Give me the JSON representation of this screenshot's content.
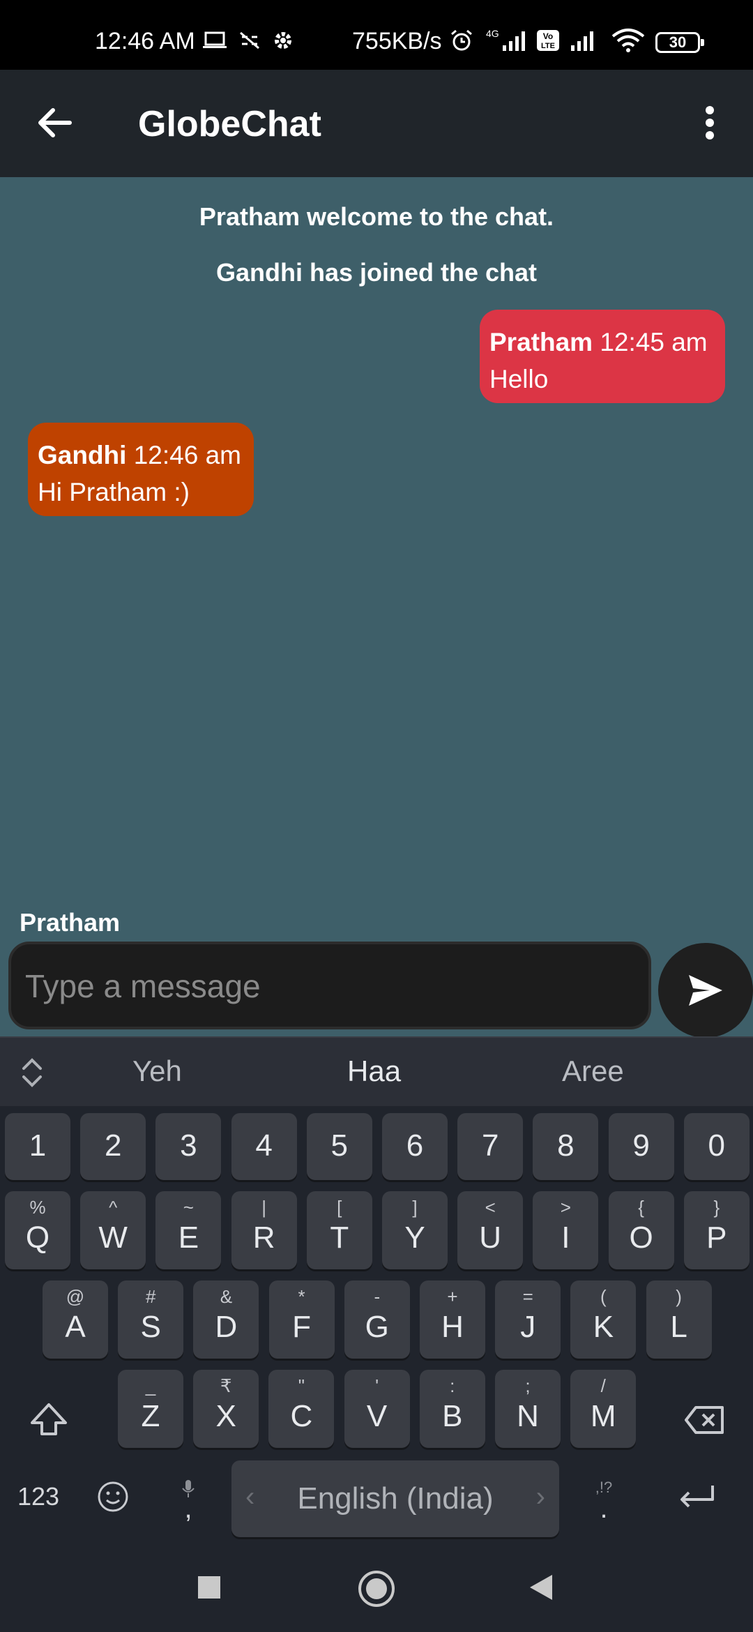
{
  "status_bar": {
    "time": "12:46 AM",
    "network_speed": "755KB/s",
    "network_type": "4G",
    "volte": "Vo LTE",
    "battery": "30",
    "icons": [
      "laptop-icon",
      "link-off-icon",
      "gear-icon",
      "alarm-icon",
      "signal-icon",
      "volte-icon",
      "signal-icon",
      "wifi-icon",
      "battery-icon"
    ]
  },
  "app_bar": {
    "title": "GlobeChat",
    "back_icon": "arrow-back-icon",
    "menu_icon": "more-vert-icon"
  },
  "chat": {
    "system_messages": [
      "Pratham welcome to the chat.",
      "Gandhi has joined the chat"
    ],
    "messages": [
      {
        "sender": "Pratham",
        "time": "12:45 am",
        "text": "Hello",
        "side": "right",
        "color": "#dc3545"
      },
      {
        "sender": "Gandhi",
        "time": "12:46 am",
        "text": "Hi Pratham :)",
        "side": "left",
        "color": "#bf4200"
      }
    ],
    "current_user": "Pratham",
    "input_placeholder": "Type a message",
    "input_value": "",
    "send_icon": "send-icon",
    "background_color": "#3e5f69"
  },
  "keyboard": {
    "suggestions": [
      "Yeh",
      "Haa",
      "Aree"
    ],
    "number_row": [
      "1",
      "2",
      "3",
      "4",
      "5",
      "6",
      "7",
      "8",
      "9",
      "0"
    ],
    "row1": [
      {
        "k": "Q",
        "s": "%"
      },
      {
        "k": "W",
        "s": "^"
      },
      {
        "k": "E",
        "s": "~"
      },
      {
        "k": "R",
        "s": "|"
      },
      {
        "k": "T",
        "s": "["
      },
      {
        "k": "Y",
        "s": "]"
      },
      {
        "k": "U",
        "s": "<"
      },
      {
        "k": "I",
        "s": ">"
      },
      {
        "k": "O",
        "s": "{"
      },
      {
        "k": "P",
        "s": "}"
      }
    ],
    "row2": [
      {
        "k": "A",
        "s": "@"
      },
      {
        "k": "S",
        "s": "#"
      },
      {
        "k": "D",
        "s": "&"
      },
      {
        "k": "F",
        "s": "*"
      },
      {
        "k": "G",
        "s": "-"
      },
      {
        "k": "H",
        "s": "+"
      },
      {
        "k": "J",
        "s": "="
      },
      {
        "k": "K",
        "s": "("
      },
      {
        "k": "L",
        "s": ")"
      }
    ],
    "row3": [
      {
        "k": "Z",
        "s": "_"
      },
      {
        "k": "X",
        "s": "₹"
      },
      {
        "k": "C",
        "s": "\""
      },
      {
        "k": "V",
        "s": "'"
      },
      {
        "k": "B",
        "s": ":"
      },
      {
        "k": "N",
        "s": ";"
      },
      {
        "k": "M",
        "s": "/"
      }
    ],
    "numbers_key": "123",
    "comma_key": ",",
    "period_key": ".",
    "period_sub": ",!?",
    "space_label": "English (India)"
  },
  "nav_bar": {
    "icons": [
      "recents-square-icon",
      "home-circle-icon",
      "back-triangle-icon"
    ]
  }
}
